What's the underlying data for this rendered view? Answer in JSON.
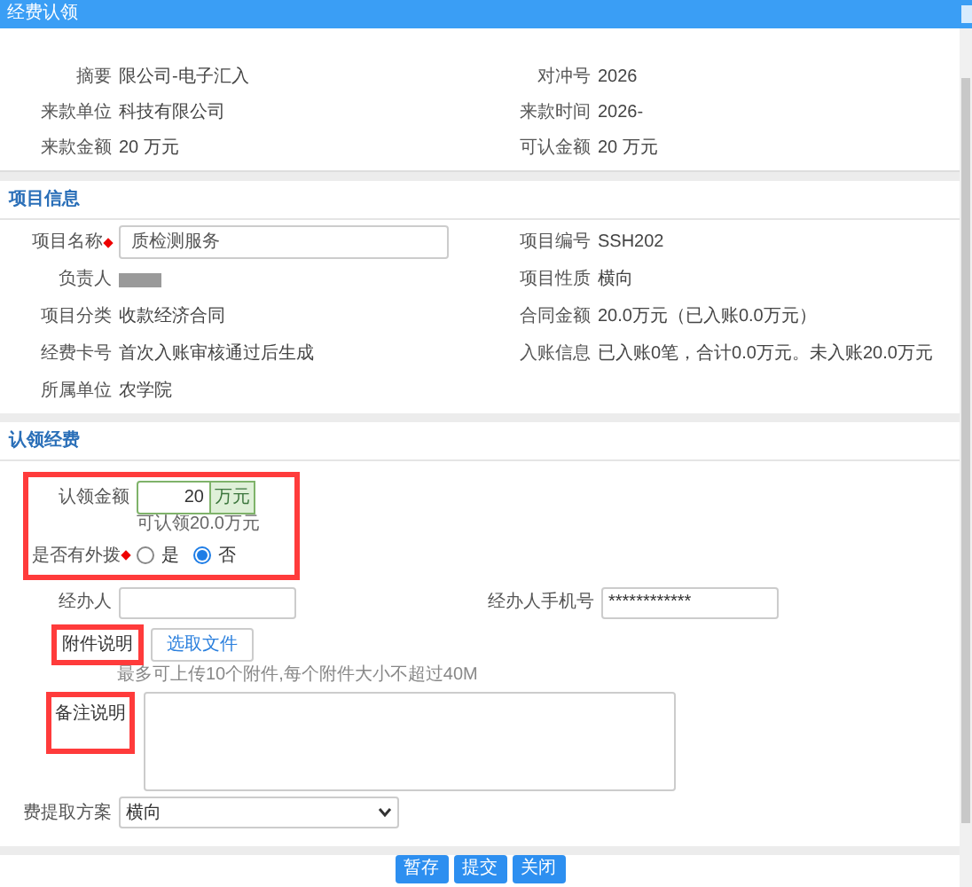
{
  "window": {
    "title": "经费认领"
  },
  "income": {
    "rows": [
      {
        "left": {
          "label": "摘要",
          "value": "限公司-电子汇入"
        },
        "right": {
          "label": "对冲号",
          "value": "2026"
        }
      },
      {
        "left": {
          "label": "来款单位",
          "value": "科技有限公司"
        },
        "right": {
          "label": "来款时间",
          "value": "2026-"
        }
      },
      {
        "left": {
          "label": "来款金额",
          "value": "20 万元"
        },
        "right": {
          "label": "可认金额",
          "value": "20 万元"
        }
      }
    ]
  },
  "project": {
    "title": "项目信息",
    "rows": [
      {
        "left": {
          "label": "项目名称",
          "value": "质检测服务",
          "kind": "input",
          "required": true
        },
        "right": {
          "label": "项目编号",
          "value": "SSH202"
        }
      },
      {
        "left": {
          "label": "负责人"
        },
        "right": {
          "label": "项目性质",
          "value": "横向"
        }
      },
      {
        "left": {
          "label": "项目分类",
          "value": "收款经济合同"
        },
        "right": {
          "label": "合同金额",
          "value": "20.0万元（已入账0.0万元）"
        }
      },
      {
        "left": {
          "label": "经费卡号",
          "value": "首次入账审核通过后生成"
        },
        "right": {
          "label": "入账信息",
          "value": "已入账0笔，合计0.0万元。未入账20.0万元"
        }
      },
      {
        "left": {
          "label": "所属单位",
          "value": "农学院"
        }
      }
    ]
  },
  "claim": {
    "title": "认领经费",
    "amount": {
      "label": "认领金额",
      "value": "20",
      "unit": "万元",
      "hint": "可认领20.0万元",
      "highlighted": true
    },
    "foreign": {
      "label": "是否有外拨",
      "required": true,
      "options": [
        {
          "label": "是",
          "selected": false
        },
        {
          "label": "否",
          "selected": true
        }
      ]
    },
    "handler": {
      "label": "经办人"
    },
    "phone": {
      "label": "经办人手机号",
      "value": "************"
    },
    "attachment": {
      "label": "附件说明",
      "button": "选取文件",
      "hint": "最多可上传10个附件,每个附件大小不超过40M",
      "highlighted": true
    },
    "remark": {
      "label": "备注说明",
      "highlighted": true
    },
    "plan": {
      "label": "费提取方案",
      "value": "横向"
    }
  },
  "buttons": [
    {
      "label": "暂存"
    },
    {
      "label": "提交"
    },
    {
      "label": "关闭"
    }
  ]
}
